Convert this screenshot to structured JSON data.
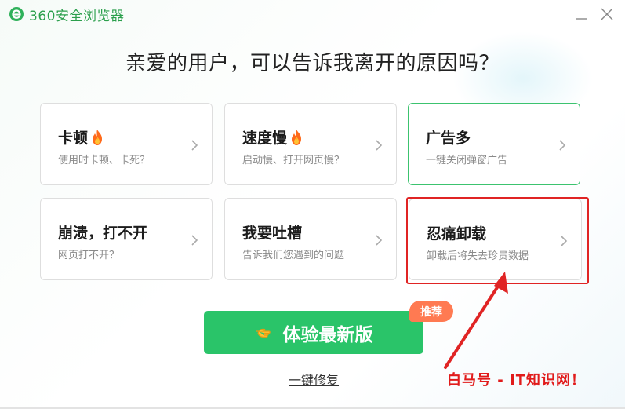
{
  "window": {
    "app_title": "360安全浏览器",
    "icons": {
      "logo": "360-browser-e-icon",
      "minimize": "minimize-icon",
      "close": "close-icon"
    }
  },
  "headline": "亲爱的用户，可以告诉我离开的原因吗？",
  "reasons": [
    {
      "title": "卡顿",
      "subtitle": "使用时卡顿、卡死？",
      "hot": true
    },
    {
      "title": "速度慢",
      "subtitle": "启动慢、打开网页慢？",
      "hot": true
    },
    {
      "title": "广告多",
      "subtitle": "一键关闭弹窗广告",
      "hot": false
    },
    {
      "title": "崩溃，打不开",
      "subtitle": "网页打不开？",
      "hot": false
    },
    {
      "title": "我要吐槽",
      "subtitle": "告诉我们您遇到的问题",
      "hot": false
    },
    {
      "title": "忍痛卸载",
      "subtitle": "卸载后将失去珍贵数据",
      "hot": false
    }
  ],
  "primary_button": {
    "label": "体验最新版",
    "icon": "pointing-hand-icon"
  },
  "badge": "推荐",
  "repair_link": "一键修复",
  "watermark": "白马号 - IT知识网！",
  "colors": {
    "accent": "#2ac469",
    "badge": "#ff7a52",
    "annotation": "#e02424",
    "logo": "#2b9f4c"
  }
}
